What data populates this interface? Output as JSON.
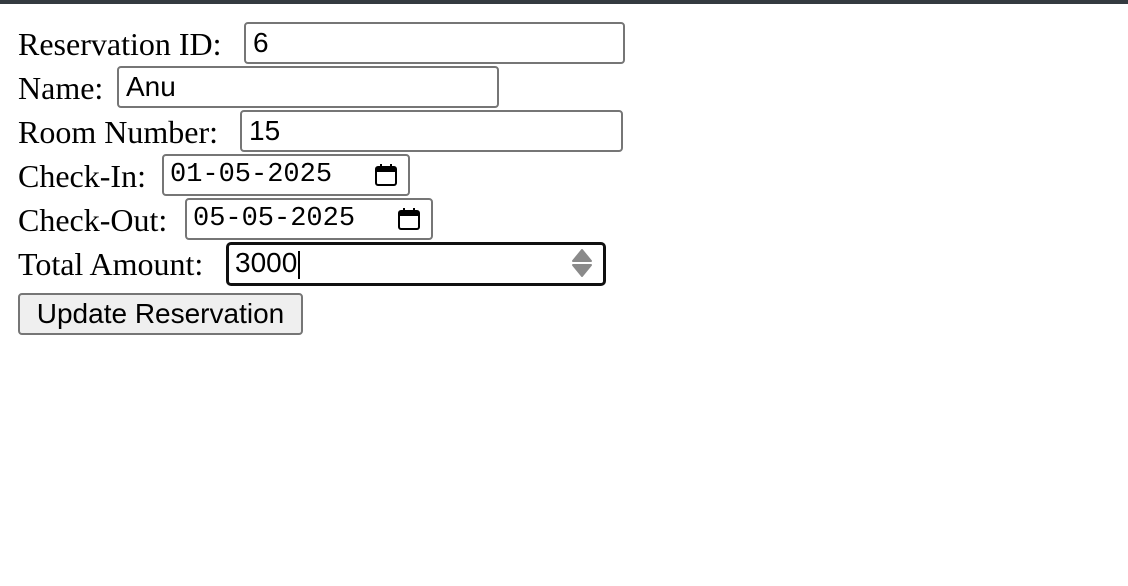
{
  "form": {
    "reservation_id": {
      "label": "Reservation ID:",
      "value": "6"
    },
    "name": {
      "label": "Name:",
      "value": "Anu"
    },
    "room_number": {
      "label": "Room Number:",
      "value": "15"
    },
    "check_in": {
      "label": "Check-In:",
      "value": "01-05-2025"
    },
    "check_out": {
      "label": "Check-Out:",
      "value": "05-05-2025"
    },
    "total_amount": {
      "label": "Total Amount:",
      "value": "3000"
    },
    "submit_label": "Update Reservation"
  },
  "icons": {
    "date_picker": "calendar-icon",
    "number_spinner": "spinner-icon"
  },
  "colors": {
    "top_bar": "#343a40",
    "input_border": "#767676",
    "focus_border": "#101010",
    "button_bg": "#efefef"
  }
}
